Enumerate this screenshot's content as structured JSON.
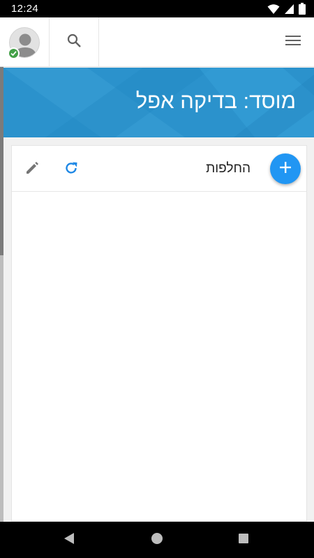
{
  "status_bar": {
    "time": "12:24",
    "icons": [
      "wifi-icon",
      "cellular-icon",
      "battery-icon"
    ]
  },
  "header": {
    "avatar_status": "online",
    "icons": [
      "avatar-icon",
      "search-icon",
      "menu-icon"
    ]
  },
  "banner": {
    "title": "מוסד: בדיקה אפל",
    "background_color": "#2b92cc"
  },
  "card": {
    "title": "החלפות",
    "icons": [
      "add-icon",
      "refresh-icon",
      "edit-icon"
    ],
    "accent_color": "#2196f3"
  },
  "nav_bar": {
    "icons": [
      "back-icon",
      "home-icon",
      "recents-icon"
    ]
  }
}
